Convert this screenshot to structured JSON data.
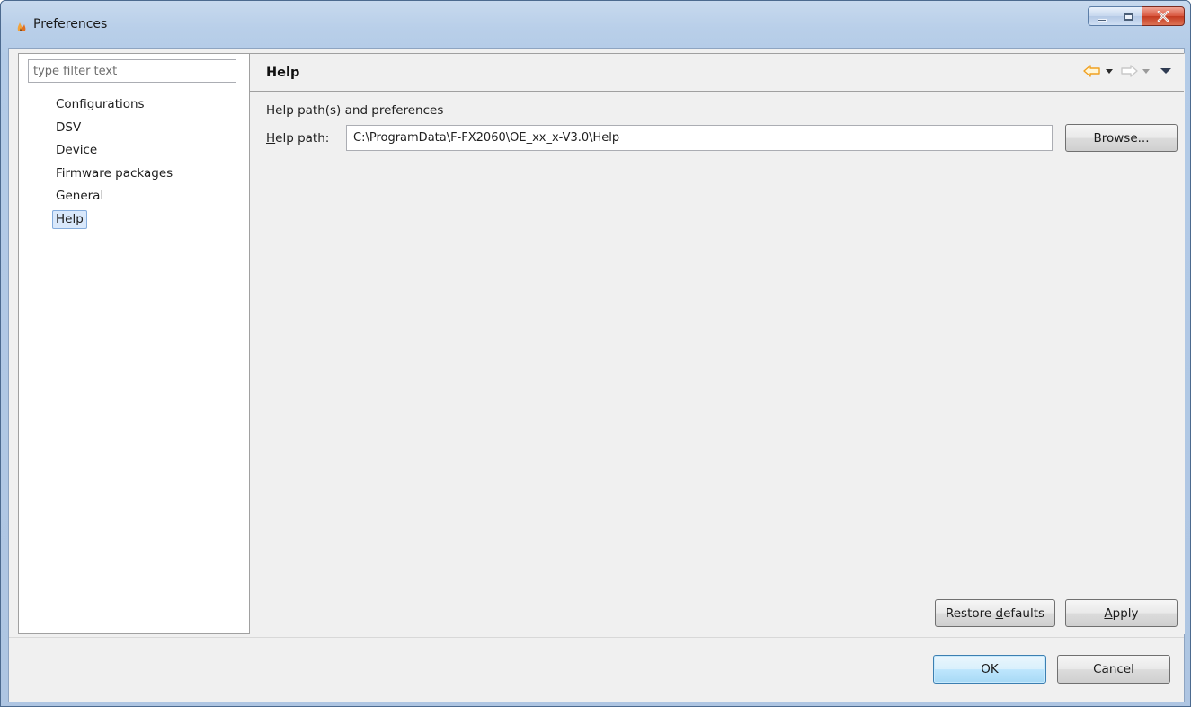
{
  "window": {
    "title": "Preferences",
    "controls": {
      "minimize": "minimize",
      "maximize": "maximize",
      "close": "X"
    }
  },
  "sidebar": {
    "filter_placeholder": "type filter text",
    "items": [
      {
        "label": "Configurations",
        "selected": false
      },
      {
        "label": "DSV",
        "selected": false
      },
      {
        "label": "Device",
        "selected": false
      },
      {
        "label": "Firmware packages",
        "selected": false
      },
      {
        "label": "General",
        "selected": false
      },
      {
        "label": "Help",
        "selected": true
      }
    ]
  },
  "page": {
    "title": "Help",
    "section_label": "Help path(s) and preferences",
    "help_path": {
      "label_mnemonic": "H",
      "label_rest": "elp path:",
      "value": "C:\\ProgramData\\F-FX2060\\OE_xx_x-V3.0\\Help"
    },
    "browse_label": "Browse...",
    "restore_label_pre": "Restore ",
    "restore_label_mnemonic": "d",
    "restore_label_post": "efaults",
    "apply_label_mnemonic": "A",
    "apply_label_rest": "pply",
    "nav_icons": [
      "back-arrow-icon",
      "forward-arrow-icon",
      "view-menu-icon"
    ],
    "colors": {
      "back_arrow": "#f0a020",
      "forward_arrow": "#c8c8c8"
    }
  },
  "footer": {
    "ok_label": "OK",
    "cancel_label": "Cancel"
  }
}
